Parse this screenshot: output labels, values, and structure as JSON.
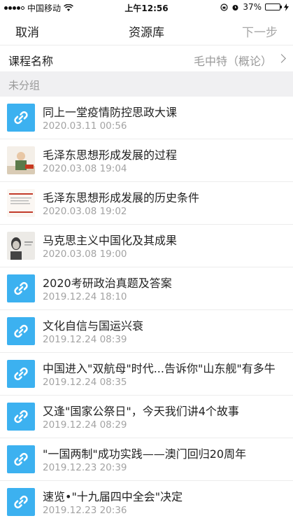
{
  "status_bar": {
    "carrier": "中国移动",
    "time": "上午12:56",
    "battery_text": "37%",
    "battery_level": 0.37
  },
  "nav": {
    "cancel": "取消",
    "title": "资源库",
    "next": "下一步"
  },
  "course": {
    "label": "课程名称",
    "value": "毛中特（概论）"
  },
  "group": {
    "label": "未分组"
  },
  "colors": {
    "link_icon_bg": "#3cb1f0",
    "secondary_text": "#a3a3a3",
    "group_bg": "#f0f0f2"
  },
  "items": [
    {
      "title": "同上一堂疫情防控思政大课",
      "date": "2020.03.11 00:56",
      "icon": "link-icon"
    },
    {
      "title": "毛泽东思想形成发展的过程",
      "date": "2020.03.08 19:04",
      "icon": "video-thumbnail"
    },
    {
      "title": "毛泽东思想形成发展的历史条件",
      "date": "2020.03.08 19:02",
      "icon": "video-thumbnail"
    },
    {
      "title": "马克思主义中国化及其成果",
      "date": "2020.03.08 19:00",
      "icon": "video-thumbnail"
    },
    {
      "title": "2020考研政治真题及答案",
      "date": "2019.12.24 18:10",
      "icon": "link-icon"
    },
    {
      "title": "文化自信与国运兴衰",
      "date": "2019.12.24 08:39",
      "icon": "link-icon"
    },
    {
      "title": "中国进入\"双航母\"时代...告诉你\"山东舰\"有多牛",
      "date": "2019.12.24 08:35",
      "icon": "link-icon"
    },
    {
      "title": "又逢\"国家公祭日\"，今天我们讲4个故事",
      "date": "2019.12.24 08:29",
      "icon": "link-icon"
    },
    {
      "title": "\"一国两制\"成功实践——澳门回归20周年",
      "date": "2019.12.23 20:39",
      "icon": "link-icon"
    },
    {
      "title": "速览•\"十九届四中全会\"决定",
      "date": "2019.12.23 20:36",
      "icon": "link-icon"
    }
  ]
}
